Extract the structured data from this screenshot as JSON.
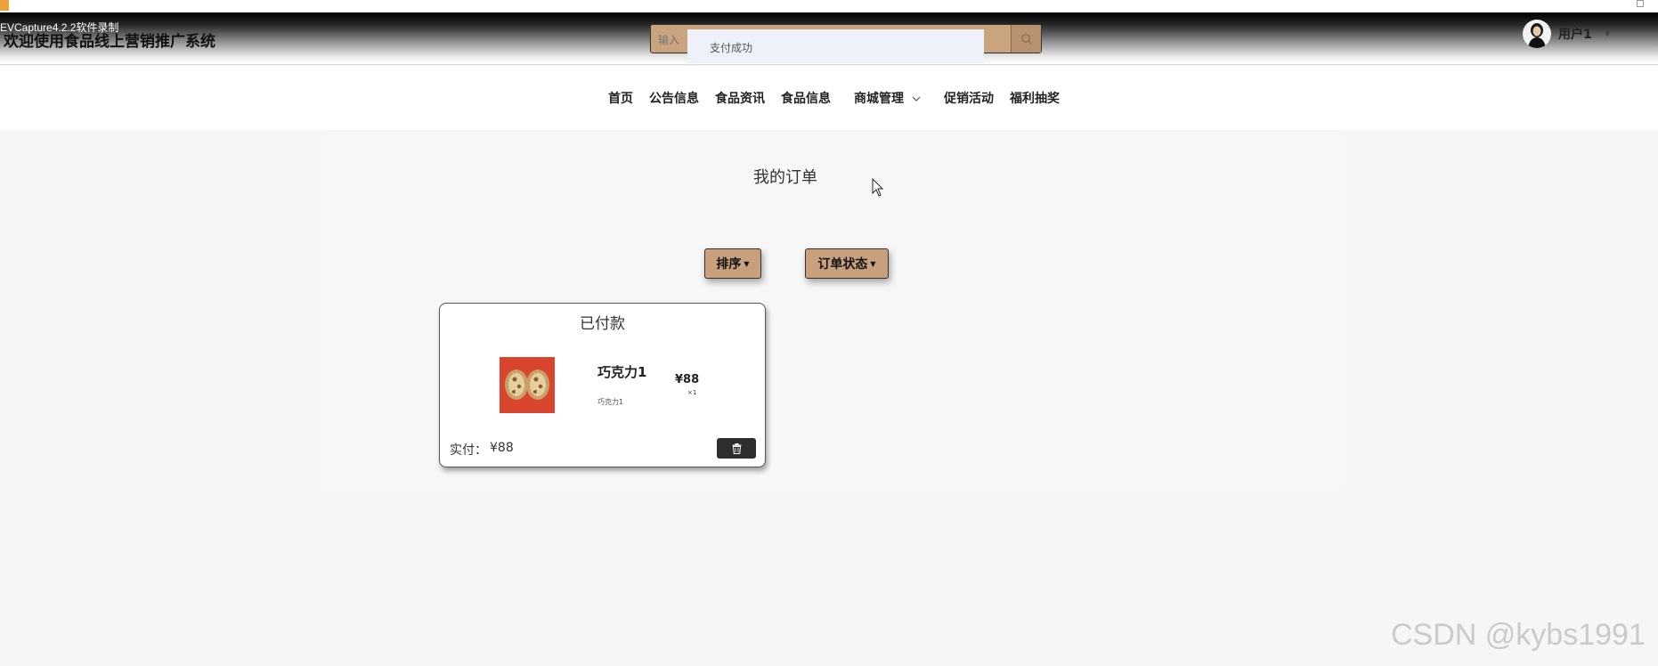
{
  "recorder_label": "EVCapture4.2.2软件录制",
  "header": {
    "site_title": "欢迎使用食品线上营销推广系统",
    "search_placeholder": "输入",
    "toast": "支付成功",
    "user_name": "用户1"
  },
  "nav": {
    "items": [
      "首页",
      "公告信息",
      "食品资讯",
      "食品信息",
      "商城管理",
      "促销活动",
      "福利抽奖"
    ]
  },
  "page": {
    "title": "我的订单",
    "sort_label": "排序",
    "status_filter_label": "订单状态"
  },
  "order": {
    "status": "已付款",
    "product_name": "巧克力1",
    "product_sub": "巧克力1",
    "price": "¥88",
    "qty": "×1",
    "paid_label": "实付：",
    "paid_value": "¥88"
  },
  "watermark": "CSDN @kybs1991",
  "colors": {
    "accent_button": "#c9a07e",
    "search_bg": "#c9a47f",
    "product_bg": "#d9452c"
  }
}
